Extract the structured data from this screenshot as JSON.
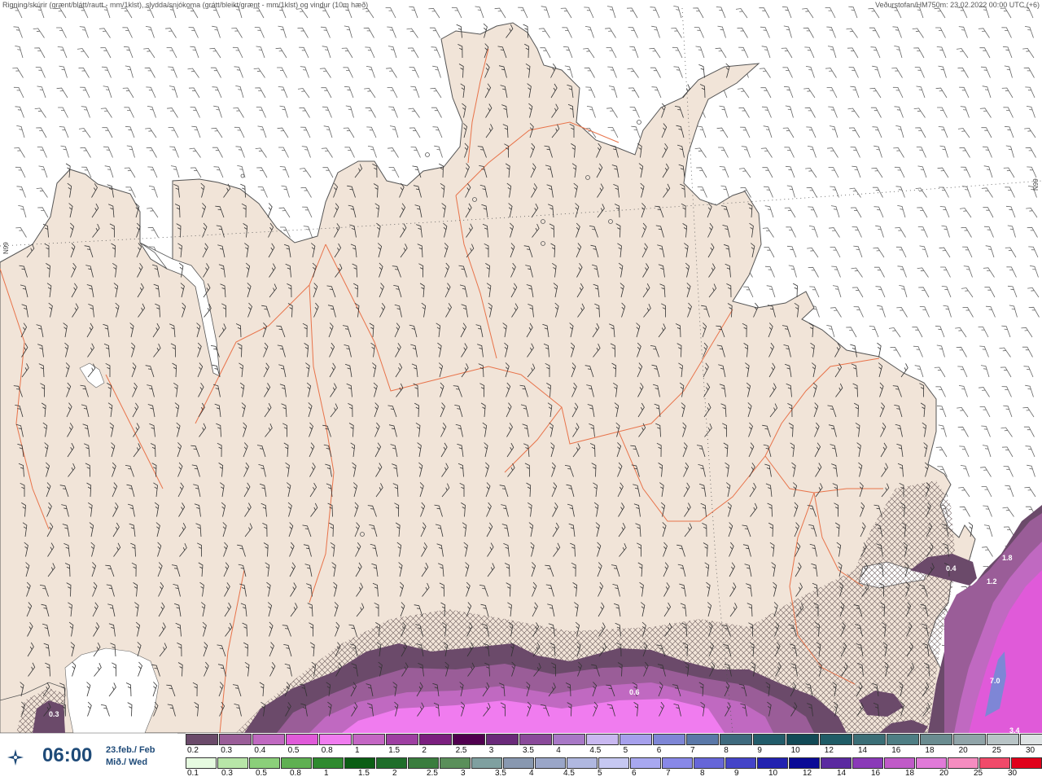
{
  "header": {
    "left_text": "Rigning/skúrir (grænt/blátt/rautt - mm/1klst), slydda/snjókoma (grátt/bleikt/grænt - mm/1klst) og vindur (10m hæð)",
    "right_text": "Veðurstofan/HM750m: 23.02.2022 00:00 UTC (+6)"
  },
  "graticule": {
    "left_label": "N99",
    "right_label": "N99"
  },
  "colors": {
    "land": "#f1e4d8",
    "sea": "#ffffff",
    "roads": "#e8734a",
    "coast": "#555555",
    "wind_barbs": "#333333"
  },
  "time_box": {
    "icon": "compass-star-icon",
    "time": "06:00",
    "date_line1": "23.feb./ Feb",
    "date_line2": "Mið./ Wed"
  },
  "field_values": [
    "0.3",
    "0.6",
    "0.4",
    "1.8",
    "1.2",
    "7.0",
    "3.4"
  ],
  "legend": {
    "snow_colors": [
      "#6b4a6a",
      "#9a5d98",
      "#c069c1",
      "#e05ad9",
      "#f07cef",
      "#c466c4",
      "#9e3fa2",
      "#7b1f7f",
      "#50004f",
      "#6a2a7a",
      "#8a4a9a",
      "#a878c6",
      "#c9b8f0",
      "#a6a0ec",
      "#7e86d6",
      "#5a78a8",
      "#3e6a7e",
      "#225c6a",
      "#124a56",
      "#1f5c66",
      "#3a6e76",
      "#4e7e84",
      "#6a8c90",
      "#90a4a8",
      "#b8c4c6",
      "#dde2e3"
    ],
    "snow_labels": [
      "0.2",
      "0.3",
      "0.4",
      "0.5",
      "0.8",
      "1",
      "1.5",
      "2",
      "2.5",
      "3",
      "3.5",
      "4",
      "4.5",
      "5",
      "6",
      "7",
      "8",
      "9",
      "10",
      "12",
      "14",
      "16",
      "18",
      "20",
      "25",
      "30"
    ],
    "rain_colors": [
      "#e6fbe0",
      "#b8e6a8",
      "#8bcf7a",
      "#5fb052",
      "#2e8a2e",
      "#0b5e14",
      "#1f6e2a",
      "#3a7d3e",
      "#5a8f5a",
      "#7fa0a0",
      "#8898b0",
      "#9aa6c8",
      "#b0b8e0",
      "#c6c8f2",
      "#a8a8f0",
      "#8888e8",
      "#6666d8",
      "#4444c8",
      "#2222b0",
      "#0a0a96",
      "#5a2aa0",
      "#8a3ab8",
      "#c05ac8",
      "#e07ad8",
      "#f58cc0",
      "#f04a6a",
      "#e0001a"
    ],
    "rain_labels": [
      "0.1",
      "0.3",
      "0.5",
      "0.8",
      "1",
      "1.5",
      "2",
      "2.5",
      "3",
      "3.5",
      "4",
      "4.5",
      "5",
      "6",
      "7",
      "8",
      "9",
      "10",
      "12",
      "14",
      "16",
      "18",
      "20",
      "25",
      "30"
    ]
  }
}
